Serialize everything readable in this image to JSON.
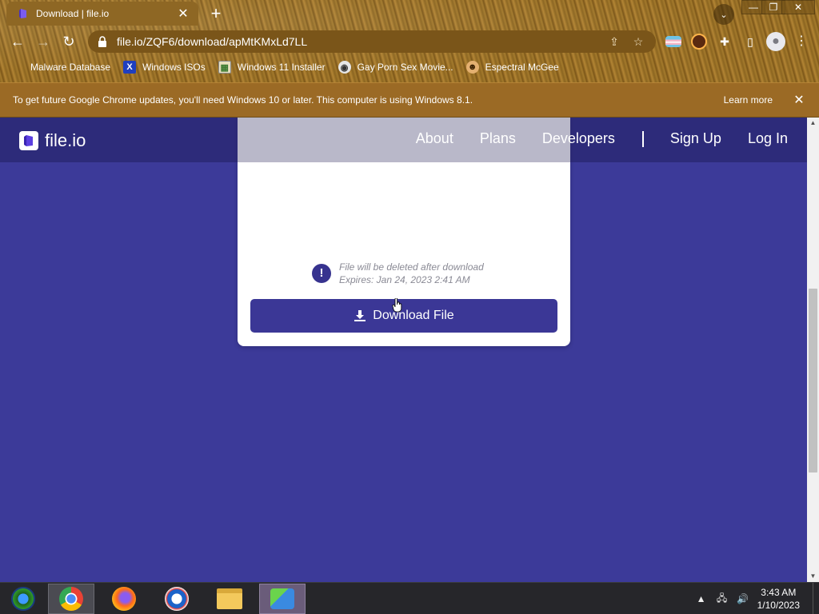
{
  "browser": {
    "tab": {
      "title": "Download | file.io"
    },
    "url": "file.io/ZQF6/download/apMtKMxLd7LL",
    "bookmarks": [
      {
        "label": "Malware Database",
        "icon": "bug-icon"
      },
      {
        "label": "Windows ISOs",
        "icon": "x-icon"
      },
      {
        "label": "Windows 11 Installer",
        "icon": "image-icon"
      },
      {
        "label": "Gay Porn Sex Movie...",
        "icon": "disc-icon"
      },
      {
        "label": "Espectral McGee",
        "icon": "face-icon"
      }
    ],
    "infobar": {
      "message": "To get future Google Chrome updates, you'll need Windows 10 or later. This computer is using Windows 8.1.",
      "learn_more": "Learn more"
    }
  },
  "site": {
    "logo_text": "file.io",
    "nav": {
      "about": "About",
      "plans": "Plans",
      "developers": "Developers",
      "divider": "|",
      "signup": "Sign Up",
      "login": "Log In"
    },
    "card": {
      "notice_line1": "File will be deleted after download",
      "notice_line2": "Expires: Jan 24, 2023 2:41 AM",
      "download_label": "Download File"
    }
  },
  "taskbar": {
    "apps": [
      "windows-media-center",
      "chrome",
      "firefox",
      "news",
      "file-explorer",
      "network-app"
    ],
    "time": "3:43 AM",
    "date": "1/10/2023"
  },
  "colors": {
    "page_bg": "#3c3a99",
    "button_bg": "#3b3796",
    "infobar_bg": "#9b6a25"
  }
}
